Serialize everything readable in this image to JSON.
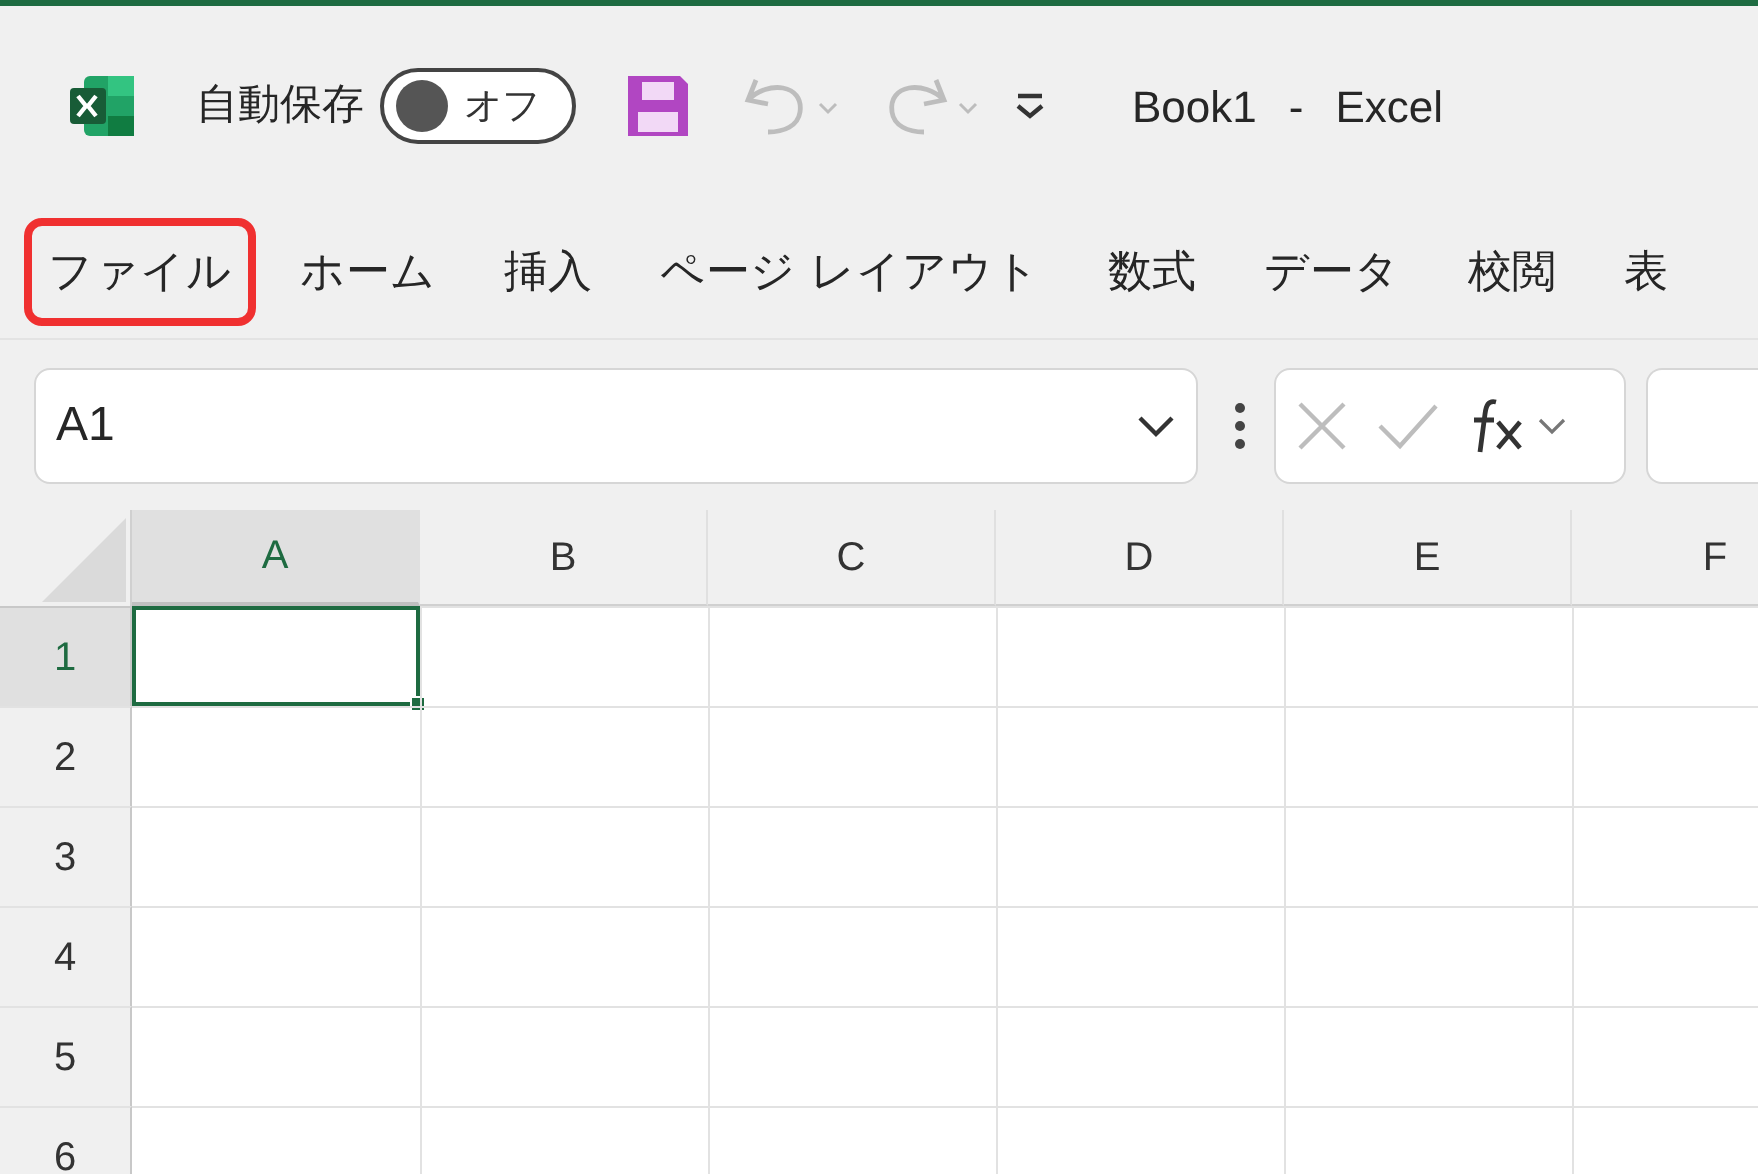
{
  "title_bar": {
    "autosave_label": "自動保存",
    "autosave_toggle": {
      "label": "オフ",
      "on": false
    },
    "title": "Book1",
    "separator": "-",
    "app_name": "Excel"
  },
  "ribbon_tabs": [
    {
      "label": "ファイル",
      "highlighted": true
    },
    {
      "label": "ホーム",
      "highlighted": false
    },
    {
      "label": "挿入",
      "highlighted": false
    },
    {
      "label": "ページ レイアウト",
      "highlighted": false
    },
    {
      "label": "数式",
      "highlighted": false
    },
    {
      "label": "データ",
      "highlighted": false
    },
    {
      "label": "校閲",
      "highlighted": false
    },
    {
      "label": "表",
      "highlighted": false
    }
  ],
  "name_box": {
    "value": "A1"
  },
  "sheet": {
    "columns": [
      {
        "label": "A",
        "selected": true
      },
      {
        "label": "B",
        "selected": false
      },
      {
        "label": "C",
        "selected": false
      },
      {
        "label": "D",
        "selected": false
      },
      {
        "label": "E",
        "selected": false
      },
      {
        "label": "F",
        "selected": false
      }
    ],
    "rows": [
      {
        "label": "1",
        "selected": true
      },
      {
        "label": "2",
        "selected": false
      },
      {
        "label": "3",
        "selected": false
      },
      {
        "label": "4",
        "selected": false
      },
      {
        "label": "5",
        "selected": false
      },
      {
        "label": "6",
        "selected": false
      }
    ]
  }
}
